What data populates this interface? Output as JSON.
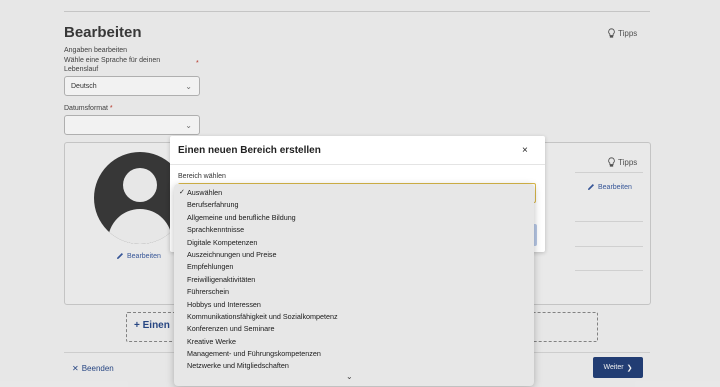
{
  "page": {
    "title": "Bearbeiten",
    "tipps_label": "Tipps",
    "section_label": "Angaben bearbeiten",
    "language_label": "Wähle eine Sprache für deinen Lebenslauf",
    "language_value": "Deutsch",
    "date_format_label": "Datumsformat",
    "required_mark": "*",
    "card_tipps_label": "Tipps",
    "card_edit_label": "Bearbeiten",
    "photo_edit_label": "Bearbeiten",
    "add_section_label": "+ Einen",
    "exit_label": "Beenden",
    "next_label": "Weiter"
  },
  "modal": {
    "title": "Einen neuen Bereich erstellen",
    "close_symbol": "×",
    "field_label": "Bereich wählen"
  },
  "dropdown": {
    "selected_index": 0,
    "options": [
      "Auswählen",
      "Berufserfahrung",
      "Allgemeine und berufliche Bildung",
      "Sprachkenntnisse",
      "Digitale Kompetenzen",
      "Auszeichnungen und Preise",
      "Empfehlungen",
      "Freiwilligenaktivitäten",
      "Führerschein",
      "Hobbys und Interessen",
      "Kommunikationsfähigkeit und Sozialkompetenz",
      "Konferenzen und Seminare",
      "Kreative Werke",
      "Management- und Führungskompetenzen",
      "Netzwerke und Mitgliedschaften"
    ]
  },
  "colors": {
    "accent": "#24417a",
    "link": "#3a5ba0",
    "focus_border": "#d9b84a"
  }
}
